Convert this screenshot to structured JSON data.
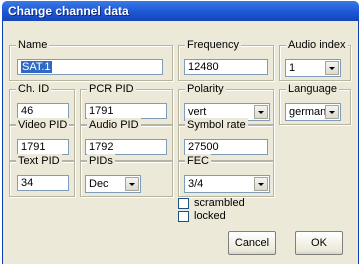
{
  "window": {
    "title": "Change channel data"
  },
  "name": {
    "label": "Name",
    "value": "SAT.1"
  },
  "frequency": {
    "label": "Frequency",
    "value": "12480"
  },
  "audio_index": {
    "label": "Audio index",
    "value": "1"
  },
  "channel_id": {
    "label": "Ch. ID",
    "value": "46"
  },
  "pcr_pid": {
    "label": "PCR PID",
    "value": "1791"
  },
  "polarity": {
    "label": "Polarity",
    "value": "vert"
  },
  "language": {
    "label": "Language",
    "value": "german"
  },
  "video_pid": {
    "label": "Video PID",
    "value": "1791"
  },
  "audio_pid": {
    "label": "Audio PID",
    "value": "1792"
  },
  "symbol_rate": {
    "label": "Symbol rate",
    "value": "27500"
  },
  "text_pid": {
    "label": "Text PID",
    "value": "34"
  },
  "pids": {
    "label": "PIDs",
    "value": "Dec"
  },
  "fec": {
    "label": "FEC",
    "value": "3/4"
  },
  "checkboxes": {
    "scrambled": "scrambled",
    "locked": "locked"
  },
  "buttons": {
    "cancel": "Cancel",
    "ok": "OK"
  }
}
